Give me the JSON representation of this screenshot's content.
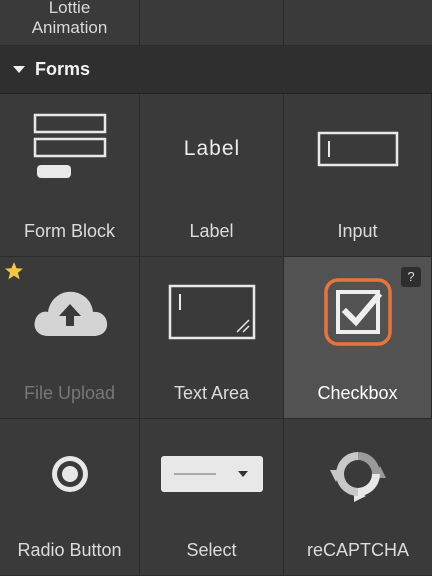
{
  "top_row": {
    "items": [
      {
        "label_line1": "Lottie",
        "label_line2": "Animation"
      },
      {
        "label_line1": "",
        "label_line2": ""
      },
      {
        "label_line1": "",
        "label_line2": ""
      }
    ]
  },
  "section": {
    "title": "Forms",
    "expanded": true
  },
  "elements": [
    {
      "label": "Form Block",
      "icon": "form-block-icon",
      "state": "normal"
    },
    {
      "label": "Label",
      "icon": "label-icon",
      "icon_text": "Label",
      "state": "normal"
    },
    {
      "label": "Input",
      "icon": "input-icon",
      "state": "normal"
    },
    {
      "label": "File Upload",
      "icon": "cloud-upload-icon",
      "state": "disabled",
      "badge": "star-icon"
    },
    {
      "label": "Text Area",
      "icon": "text-area-icon",
      "state": "normal"
    },
    {
      "label": "Checkbox",
      "icon": "checkbox-icon",
      "state": "selected",
      "help": "?"
    },
    {
      "label": "Radio Button",
      "icon": "radio-button-icon",
      "state": "normal"
    },
    {
      "label": "Select",
      "icon": "select-dropdown-icon",
      "state": "normal"
    },
    {
      "label": "reCAPTCHA",
      "icon": "recaptcha-icon",
      "state": "normal"
    }
  ],
  "colors": {
    "panel": "#3a3a3a",
    "header": "#2f2f2f",
    "selected": "#525252",
    "accent_orange": "#e8743b",
    "star": "#f5c542"
  }
}
